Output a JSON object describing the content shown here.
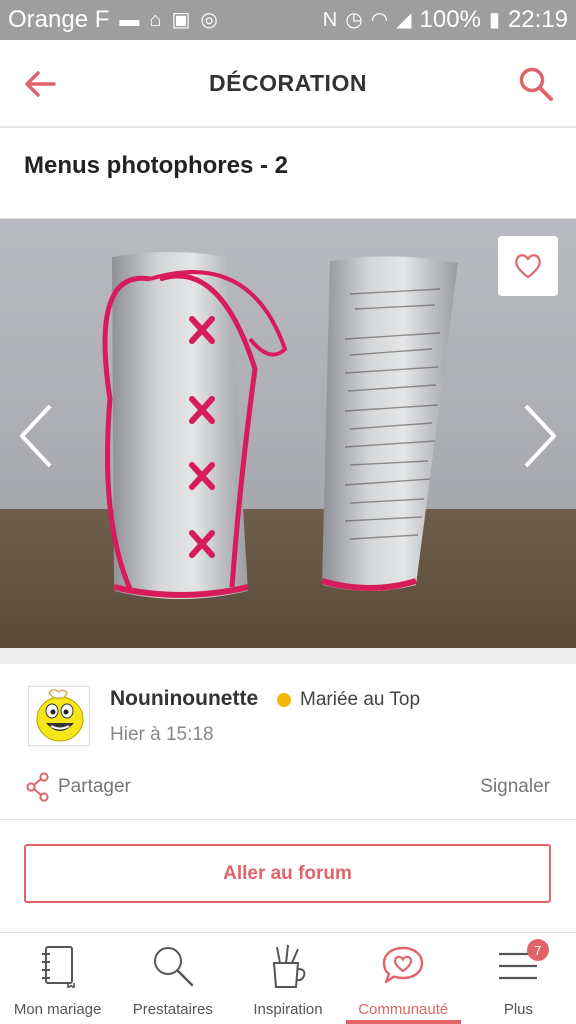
{
  "status_bar": {
    "carrier": "Orange F",
    "battery": "100%",
    "time": "22:19"
  },
  "header": {
    "title": "DÉCORATION"
  },
  "post": {
    "title": "Menus photophores - 2"
  },
  "author": {
    "name": "Nouninounette",
    "badge": "Mariée au Top",
    "time": "Hier à 15:18"
  },
  "actions": {
    "share_label": "Partager",
    "report_label": "Signaler"
  },
  "forum_button": "Aller au forum",
  "bottom_nav": {
    "items": [
      {
        "label": "Mon mariage",
        "icon": "notebook-icon"
      },
      {
        "label": "Prestataires",
        "icon": "search-icon"
      },
      {
        "label": "Inspiration",
        "icon": "pencil-cup-icon"
      },
      {
        "label": "Communauté",
        "icon": "heart-bubble-icon",
        "active": true
      },
      {
        "label": "Plus",
        "icon": "menu-icon",
        "badge": "7"
      }
    ]
  },
  "colors": {
    "accent": "#e0646a",
    "status_bar": "#9e9e9e",
    "badge_dot": "#f2b705"
  }
}
